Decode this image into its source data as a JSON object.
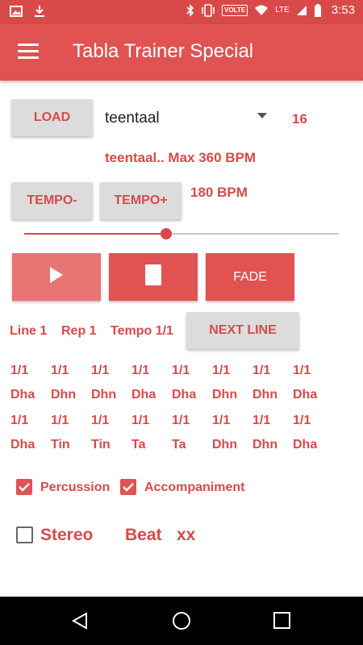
{
  "status_bar": {
    "network": "LTE",
    "volte": "VOLTE",
    "time": "3:53"
  },
  "app_bar": {
    "title": "Tabla Trainer Special"
  },
  "controls": {
    "load_label": "LOAD",
    "taal_value": "teentaal",
    "taal_count": "16",
    "info": "teentaal.. Max 360 BPM",
    "tempo_minus": "TEMPO-",
    "tempo_plus": "TEMPO+",
    "bpm": "180 BPM",
    "tempo_slider_fraction": 0.45,
    "fade_label": "FADE",
    "next_line_label": "NEXT LINE"
  },
  "status": {
    "line": "Line 1",
    "rep": "Rep 1",
    "tempo": "Tempo 1/1"
  },
  "grid": {
    "row1_fractions": [
      "1/1",
      "1/1",
      "1/1",
      "1/1",
      "1/1",
      "1/1",
      "1/1",
      "1/1"
    ],
    "row1_bols": [
      "Dha",
      "Dhn",
      "Dhn",
      "Dha",
      "Dha",
      "Dhn",
      "Dhn",
      "Dha"
    ],
    "row2_fractions": [
      "1/1",
      "1/1",
      "1/1",
      "1/1",
      "1/1",
      "1/1",
      "1/1",
      "1/1"
    ],
    "row2_bols": [
      "Dha",
      "Tin",
      "Tin",
      "Ta",
      "Ta",
      "Dhn",
      "Dhn",
      "Dha"
    ]
  },
  "options": {
    "percussion": {
      "label": "Percussion",
      "checked": true
    },
    "accompaniment": {
      "label": "Accompaniment",
      "checked": true
    },
    "stereo": {
      "label": "Stereo",
      "checked": false
    },
    "beat_label": "Beat",
    "beat_value": "xx"
  },
  "colors": {
    "accent": "#e05352",
    "status_bar": "#d84a49",
    "button_gray": "#dcdcdc"
  },
  "icons": [
    "image-icon",
    "download-icon",
    "bluetooth-icon",
    "vibrate-icon",
    "wifi-icon",
    "signal-icon",
    "battery-icon",
    "menu-icon",
    "play-icon",
    "stop-icon",
    "back-icon",
    "home-icon",
    "recents-icon"
  ]
}
